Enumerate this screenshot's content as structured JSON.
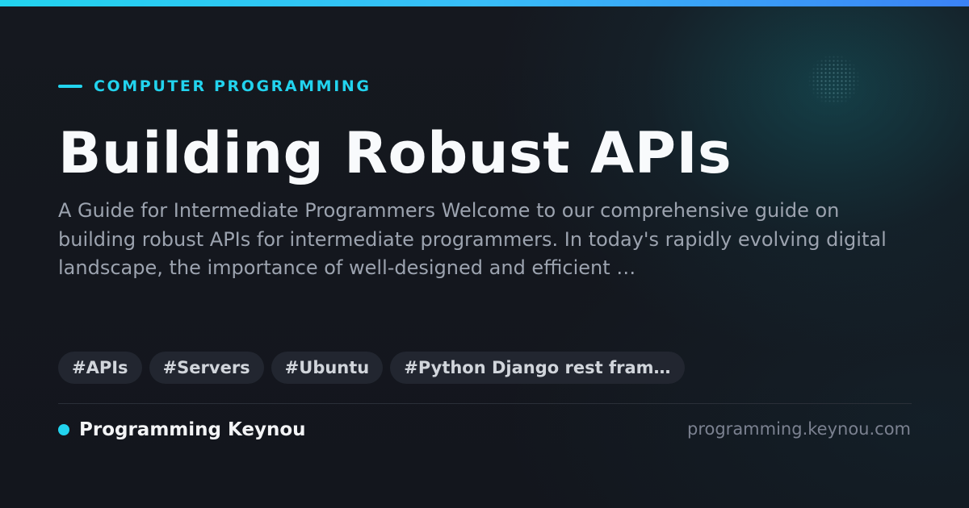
{
  "category": {
    "label": "COMPUTER PROGRAMMING"
  },
  "article": {
    "title": "Building Robust APIs",
    "description": "A Guide for Intermediate Programmers Welcome to our comprehensive guide on building robust APIs for intermediate programmers. In today's rapidly evolving digital landscape, the importance of well-designed and efficient …"
  },
  "tags": [
    {
      "label": "#APIs"
    },
    {
      "label": "#Servers"
    },
    {
      "label": "#Ubuntu"
    },
    {
      "label": "#Python Django rest fram…"
    }
  ],
  "footer": {
    "site_name": "Programming Keynou",
    "domain": "programming.keynou.com"
  },
  "colors": {
    "accent": "#22d3ee",
    "background": "#14171e",
    "title": "#f8fafc",
    "description": "#9ca3af",
    "tag_background": "#222630"
  }
}
